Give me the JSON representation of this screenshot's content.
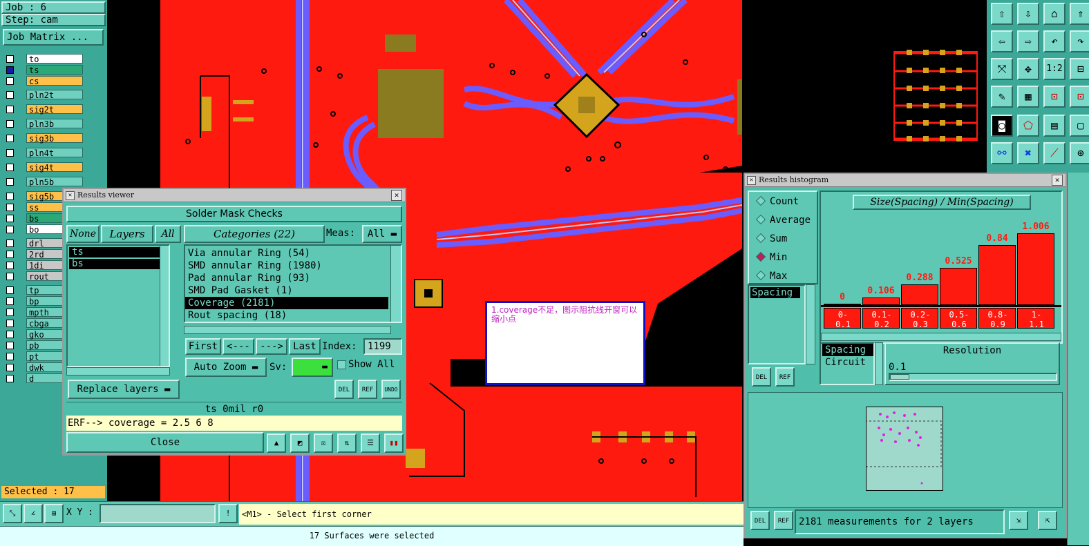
{
  "job": {
    "job_label": "Job : 6",
    "step_label": "Step: cam",
    "matrix_button": "Job Matrix ..."
  },
  "layers": [
    {
      "name": "to",
      "color": "#ffffff",
      "checked": false
    },
    {
      "name": "ts",
      "color": "#2aa878",
      "checked": true
    },
    {
      "name": "cs",
      "color": "#ffc04a",
      "checked": false
    },
    {
      "name": "pln2t",
      "color": "#6fd0bf",
      "checked": false
    },
    {
      "name": "sig2t",
      "color": "#ffc04a",
      "checked": false
    },
    {
      "name": "pln3b",
      "color": "#6fd0bf",
      "checked": false
    },
    {
      "name": "sig3b",
      "color": "#ffc04a",
      "checked": false
    },
    {
      "name": "pln4t",
      "color": "#6fd0bf",
      "checked": false
    },
    {
      "name": "sig4t",
      "color": "#ffc04a",
      "checked": false
    },
    {
      "name": "pln5b",
      "color": "#6fd0bf",
      "checked": false
    },
    {
      "name": "sig5b",
      "color": "#ffc04a",
      "checked": false
    },
    {
      "name": "ss",
      "color": "#ffc04a",
      "checked": false
    },
    {
      "name": "bs",
      "color": "#2aa878",
      "checked": false
    },
    {
      "name": "bo",
      "color": "#ffffff",
      "checked": false
    },
    {
      "name": "drl",
      "color": "#c7c7c7",
      "checked": false
    },
    {
      "name": "2rd",
      "color": "#c7c7c7",
      "checked": false
    },
    {
      "name": "1di",
      "color": "#c7c7c7",
      "checked": false
    },
    {
      "name": "rout",
      "color": "#c7c7c7",
      "checked": false
    },
    {
      "name": "tp",
      "color": "#6fd0bf",
      "checked": false
    },
    {
      "name": "bp",
      "color": "#6fd0bf",
      "checked": false
    },
    {
      "name": "mpth",
      "color": "#6fd0bf",
      "checked": false
    },
    {
      "name": "cbga",
      "color": "#6fd0bf",
      "checked": false
    },
    {
      "name": "gko",
      "color": "#6fd0bf",
      "checked": false
    },
    {
      "name": "pb",
      "color": "#6fd0bf",
      "checked": false
    },
    {
      "name": "pt",
      "color": "#6fd0bf",
      "checked": false
    },
    {
      "name": "dwk",
      "color": "#6fd0bf",
      "checked": false
    },
    {
      "name": "d",
      "color": "#6fd0bf",
      "checked": false
    }
  ],
  "selected_label": "Selected : 17",
  "results_viewer": {
    "title": "Results viewer",
    "header": "Solder Mask Checks",
    "none_btn": "None",
    "layers_btn": "Layers",
    "all_btn": "All",
    "layer_list": [
      "ts",
      "bs"
    ],
    "categories_label": "Categories (22)",
    "meas_label": "Meas:",
    "meas_value": "All",
    "categories": [
      "Via annular Ring (54)",
      "SMD annular Ring (1980)",
      "Pad annular Ring (93)",
      "SMD Pad Gasket (1)",
      "Coverage (2181)",
      "Rout spacing (18)"
    ],
    "selected_category_index": 4,
    "first_btn": "First",
    "prev_btn": "<---",
    "next_btn": "--->",
    "last_btn": "Last",
    "index_label": "Index:",
    "index_value": "1199",
    "auto_zoom": "Auto Zoom",
    "sv_label": "Sv:",
    "show_all": "Show All",
    "replace_layers": "Replace layers",
    "del": "DEL",
    "ref": "REF",
    "undo": "UNDO",
    "status": "ts 0mil  r0",
    "erf": "ERF--> coverage = 2.5 6 8",
    "close": "Close"
  },
  "note": {
    "text": "1.coverage不足，图示阻抗线开窗可以缩小点"
  },
  "histogram": {
    "title": "Results histogram",
    "options": [
      "Count",
      "Average",
      "Sum",
      "Min",
      "Max"
    ],
    "selected_option": "Min",
    "chart_title": "Size(Spacing) / Min(Spacing)",
    "list_item": "Spacing",
    "list2": [
      "Spacing",
      "Circuit"
    ],
    "resolution_label": "Resolution",
    "resolution_value": "0.1",
    "del": "DEL",
    "ref": "REF",
    "measurements": "2181 measurements for 2 layers"
  },
  "chart_data": {
    "type": "bar",
    "title": "Size(Spacing) / Min(Spacing)",
    "categories": [
      "0-\n0.1",
      "0.1-\n0.2",
      "0.2-\n0.3",
      "0.5-\n0.6",
      "0.8-\n0.9",
      "1-\n1.1"
    ],
    "values": [
      0,
      0.106,
      0.288,
      0.525,
      0.84,
      1.006
    ],
    "value_labels": [
      "0",
      "0.106",
      "0.288",
      "0.525",
      "0.84",
      "1.006"
    ],
    "ylim": [
      0,
      1.1
    ],
    "bar_color": "#ff1a10"
  },
  "bottom": {
    "xy_label": "X Y :",
    "xy_value": "",
    "prompt": "<M1> - Select first corner",
    "message": "17 Surfaces were selected"
  },
  "toolbar_icons": [
    "move-up-icon",
    "move-down-icon",
    "home-icon",
    "arrow-left-icon",
    "arrow-right-icon",
    "undo-icon",
    "fit-icon",
    "zoom-icon",
    "ratio-icon",
    "measure-icon",
    "grid-icon",
    "snap-icon",
    "camera-icon",
    "edit-icon",
    "ruler-icon",
    "net-icon",
    "cross-icon",
    "line-icon"
  ],
  "ratio_label": "1:2",
  "colors": {
    "canvas": "#ff1a10",
    "panel": "#5fc8b4",
    "trace": "#6b5cff",
    "pad": "#d4a51c"
  }
}
